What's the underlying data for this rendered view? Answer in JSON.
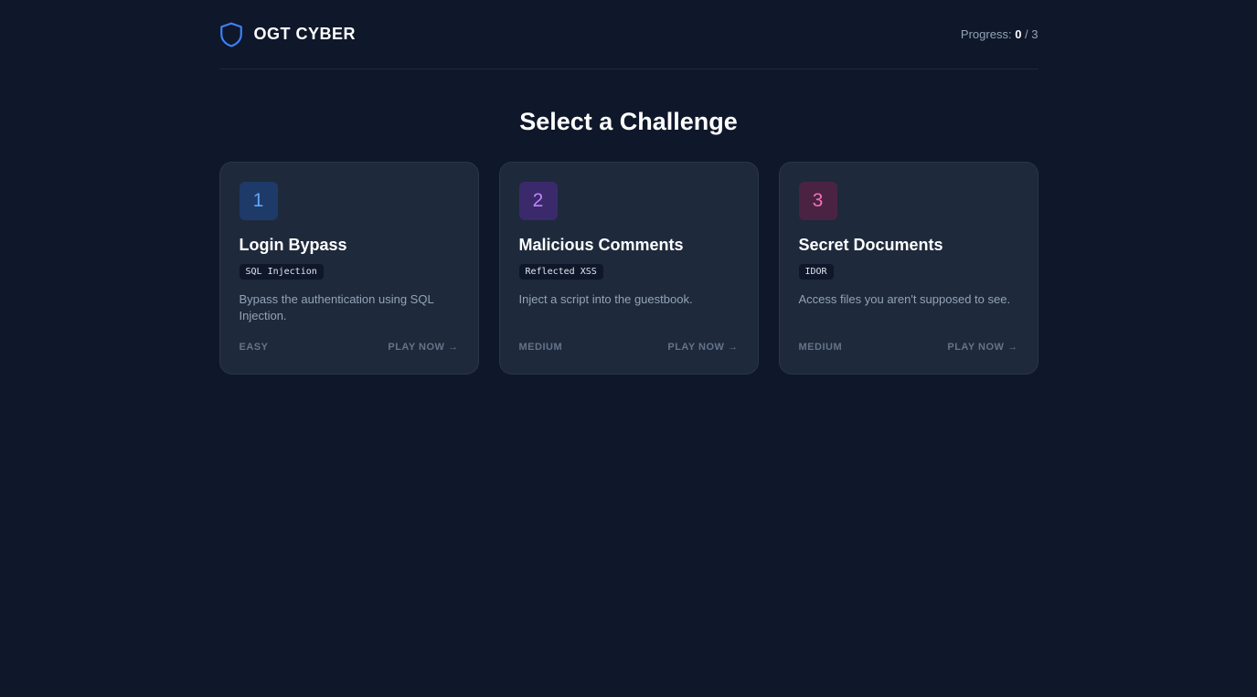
{
  "header": {
    "brand": "OGT CYBER",
    "brand_icon": "shield-icon",
    "progress_label": "Progress:",
    "progress_done": "0",
    "progress_sep": " / ",
    "progress_total": "3",
    "accent": "#3b82f6"
  },
  "main": {
    "title": "Select a Challenge"
  },
  "challenges": [
    {
      "number": "1",
      "title": "Login Bypass",
      "tag": "SQL Injection",
      "description": "Bypass the authentication using SQL Injection.",
      "difficulty": "EASY",
      "cta": "PLAY NOW →",
      "badge_bg": "#1e3a68",
      "badge_fg": "#60a5fa"
    },
    {
      "number": "2",
      "title": "Malicious Comments",
      "tag": "Reflected XSS",
      "description": "Inject a script into the guestbook.",
      "difficulty": "MEDIUM",
      "cta": "PLAY NOW →",
      "badge_bg": "#3a2a6b",
      "badge_fg": "#c084fc"
    },
    {
      "number": "3",
      "title": "Secret Documents",
      "tag": "IDOR",
      "description": "Access files you aren't supposed to see.",
      "difficulty": "MEDIUM",
      "cta": "PLAY NOW →",
      "badge_bg": "#4a2342",
      "badge_fg": "#f472b6"
    }
  ]
}
